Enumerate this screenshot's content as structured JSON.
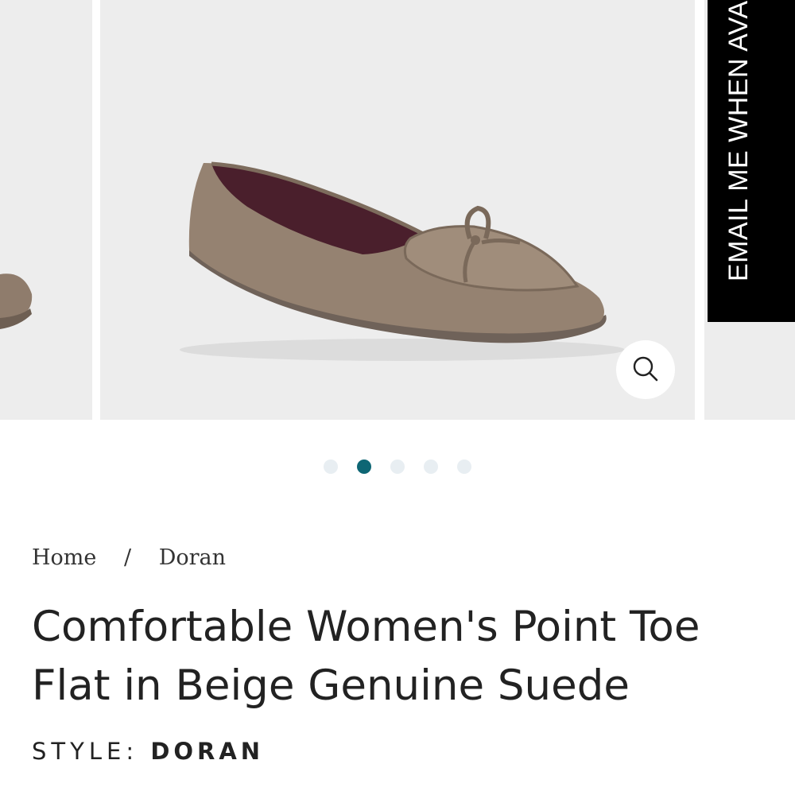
{
  "gallery": {
    "email_tab_label": "EMAIL ME WHEN AVA",
    "zoom_icon": "search-icon",
    "dots": [
      {
        "active": false
      },
      {
        "active": true
      },
      {
        "active": false
      },
      {
        "active": false
      },
      {
        "active": false
      }
    ],
    "colors": {
      "slide_bg": "#ededed",
      "active_dot": "#0e6674",
      "inactive_dot": "#e8eef2"
    }
  },
  "breadcrumb": {
    "home": "Home",
    "separator": "/",
    "current": "Doran"
  },
  "product": {
    "title": "Comfortable Women's Point Toe Flat in Beige Genuine Suede",
    "style_label": "STYLE:",
    "style_value": "DORAN"
  }
}
